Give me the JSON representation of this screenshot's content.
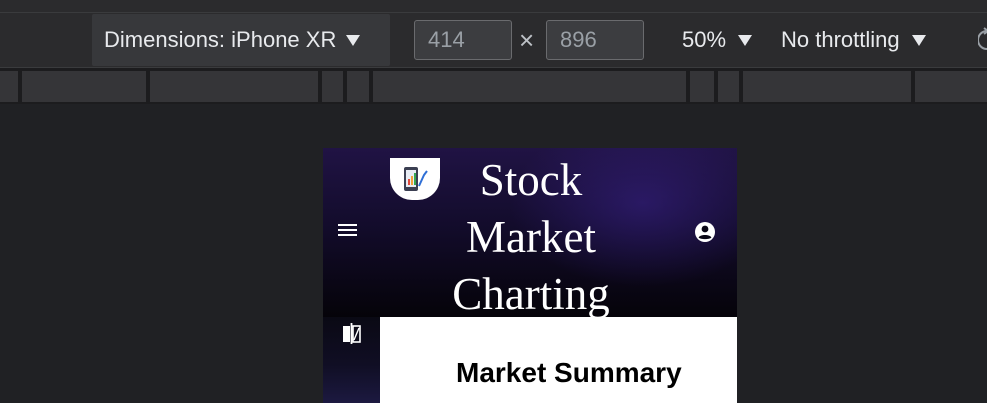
{
  "devtools": {
    "dimensions_dropdown_label": "Dimensions: iPhone XR",
    "width_value": "414",
    "height_value": "896",
    "times_symbol": "×",
    "zoom_label": "50%",
    "throttling_label": "No throttling"
  },
  "app": {
    "title": "Stock Market Charting",
    "section_heading": "Market Summary"
  },
  "colors": {
    "devtools_bg": "#202124",
    "toolbar_bg": "#2b2b2d",
    "header_gradient_top": "#201344",
    "header_gradient_bottom": "#050309"
  },
  "icons": [
    "caret-down-icon",
    "rotate-icon",
    "menu-icon",
    "app-logo-icon",
    "account-circle-icon",
    "compare-icon"
  ]
}
